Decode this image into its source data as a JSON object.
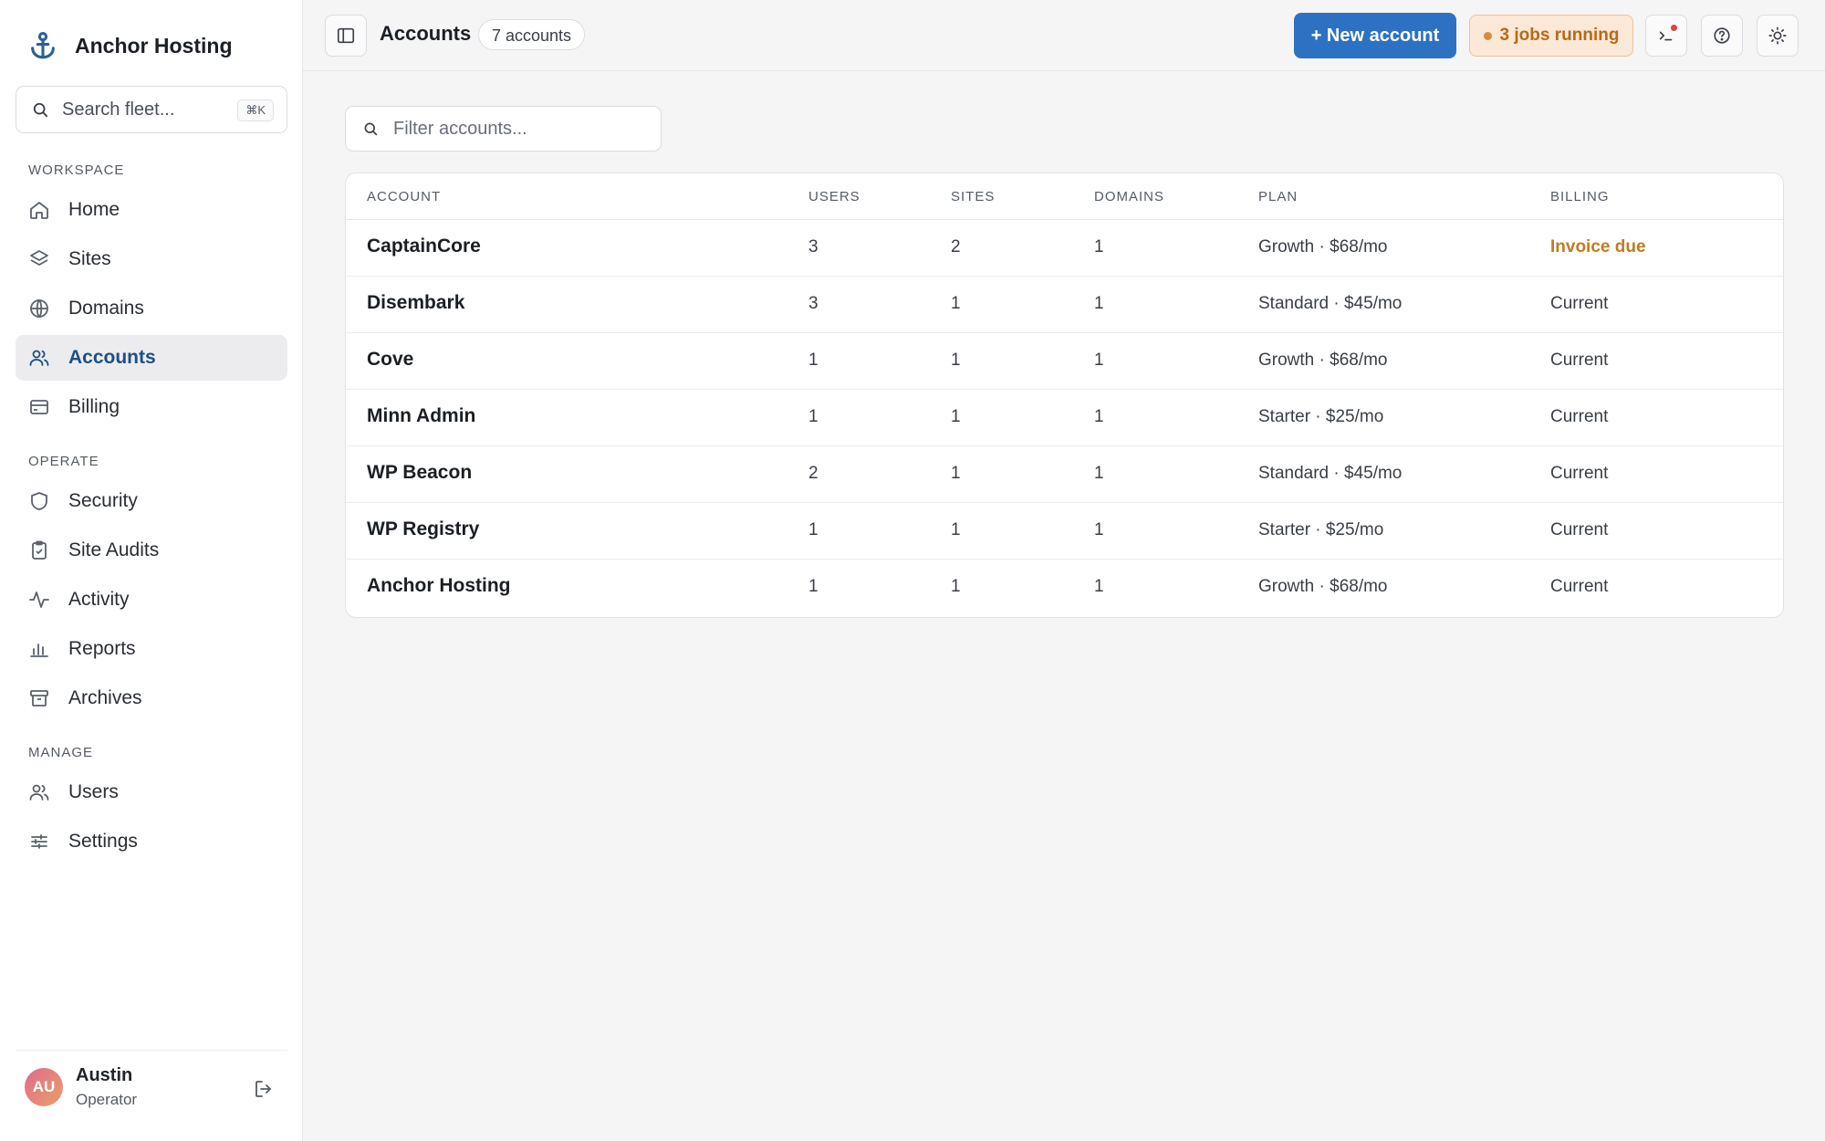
{
  "app": {
    "name": "Anchor Hosting"
  },
  "search": {
    "placeholder": "Search fleet...",
    "shortcut": "⌘K"
  },
  "sidebar": {
    "sections": [
      {
        "label": "WORKSPACE",
        "items": [
          {
            "label": "Home",
            "icon": "home-icon"
          },
          {
            "label": "Sites",
            "icon": "layers-icon"
          },
          {
            "label": "Domains",
            "icon": "globe-icon"
          },
          {
            "label": "Accounts",
            "icon": "users-icon",
            "active": true
          },
          {
            "label": "Billing",
            "icon": "credit-card-icon"
          }
        ]
      },
      {
        "label": "OPERATE",
        "items": [
          {
            "label": "Security",
            "icon": "shield-icon"
          },
          {
            "label": "Site Audits",
            "icon": "clipboard-icon"
          },
          {
            "label": "Activity",
            "icon": "activity-icon"
          },
          {
            "label": "Reports",
            "icon": "bar-chart-icon"
          },
          {
            "label": "Archives",
            "icon": "archive-icon"
          }
        ]
      },
      {
        "label": "MANAGE",
        "items": [
          {
            "label": "Users",
            "icon": "users-icon"
          },
          {
            "label": "Settings",
            "icon": "sliders-icon"
          }
        ]
      }
    ]
  },
  "user": {
    "initials": "AU",
    "name": "Austin",
    "role": "Operator"
  },
  "header": {
    "title": "Accounts",
    "count": "7 accounts",
    "new_button": "+ New account",
    "jobs": "3 jobs running"
  },
  "filter": {
    "placeholder": "Filter accounts..."
  },
  "table": {
    "columns": [
      "ACCOUNT",
      "USERS",
      "SITES",
      "DOMAINS",
      "PLAN",
      "BILLING"
    ],
    "rows": [
      {
        "account": "CaptainCore",
        "users": "3",
        "sites": "2",
        "domains": "1",
        "plan": "Growth · $68/mo",
        "billing": "Invoice due"
      },
      {
        "account": "Disembark",
        "users": "3",
        "sites": "1",
        "domains": "1",
        "plan": "Standard · $45/mo",
        "billing": "Current"
      },
      {
        "account": "Cove",
        "users": "1",
        "sites": "1",
        "domains": "1",
        "plan": "Growth · $68/mo",
        "billing": "Current"
      },
      {
        "account": "Minn Admin",
        "users": "1",
        "sites": "1",
        "domains": "1",
        "plan": "Starter · $25/mo",
        "billing": "Current"
      },
      {
        "account": "WP Beacon",
        "users": "2",
        "sites": "1",
        "domains": "1",
        "plan": "Standard · $45/mo",
        "billing": "Current"
      },
      {
        "account": "WP Registry",
        "users": "1",
        "sites": "1",
        "domains": "1",
        "plan": "Starter · $25/mo",
        "billing": "Current"
      },
      {
        "account": "Anchor Hosting",
        "users": "1",
        "sites": "1",
        "domains": "1",
        "plan": "Growth · $68/mo",
        "billing": "Current"
      }
    ]
  },
  "colors": {
    "accent": "#2d72c2",
    "active_nav": "#1d4f86",
    "warning": "#c47a1e"
  }
}
